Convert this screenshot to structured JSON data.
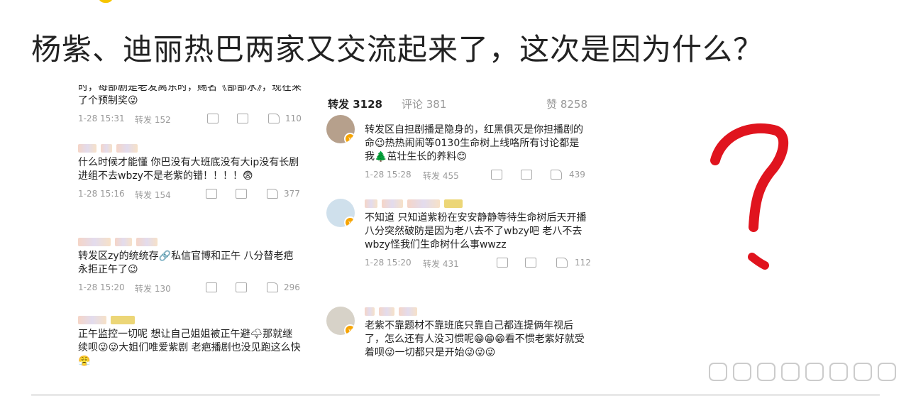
{
  "title": "杨紫、迪丽热巴两家又交流起来了，这次是因为什么？",
  "left_panel": {
    "comments": [
      {
        "text": "时，每部剧是老发离东时，赐名《部部水》，现在来了个预制奖😜",
        "time": "1-28 15:31",
        "repost": "转发 152",
        "likes": "110"
      },
      {
        "text": "什么时候才能懂 你巴没有大班底没有大ip没有长剧进组不去wbzy不是老紫的错！！！！😨",
        "time": "1-28 15:16",
        "repost": "转发 154",
        "likes": "377"
      },
      {
        "text": "转发区zy的统统存🔗私信官博和正午 八分替老疤永拒正午了😉",
        "time": "1-28 15:20",
        "repost": "转发 130",
        "likes": "296"
      },
      {
        "text": "正午监控一切呢 想让自己姐姐被正午避🌩那就继续呗😜😜大姐们唯爱紫剧 老疤播剧也没见跑这么快😤",
        "time": "",
        "repost": "",
        "likes": ""
      }
    ]
  },
  "right_panel": {
    "tabs": {
      "repost": "转发 3128",
      "comment": "评论 381",
      "like": "赞 8258"
    },
    "comments": [
      {
        "text": "转发区自担剧播是隐身的，红黑俱灭是你担播剧的命😉热热闹闹等0130生命树上线咯所有讨论都是我🌲茁壮生长的养料😊",
        "time": "1-28 15:28",
        "repost": "转发 455",
        "likes": "439"
      },
      {
        "text": "不知道 只知道紫粉在安安静静等待生命树后天开播 八分突然破防是因为老八去不了wbzy吧 老八不去wbzy怪我们生命树什么事wwzz",
        "time": "1-28 15:20",
        "repost": "转发 431",
        "likes": "112"
      },
      {
        "text": "老紫不靠题材不靠班底只靠自己都连提俩年视后了，怎么还有人没习惯呢😁😁😁看不惯老紫好就受着呗😜一切都只是开始😜😜😜",
        "time": "",
        "repost": "",
        "likes": ""
      }
    ]
  },
  "colors": {
    "question_mark": "#e0141e",
    "verified_badge": "#f7a400"
  }
}
